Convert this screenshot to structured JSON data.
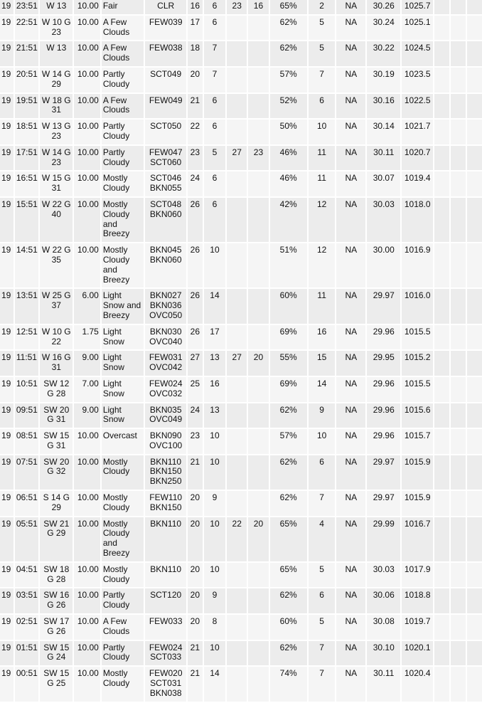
{
  "table": {
    "rows": [
      [
        "19",
        "23:51",
        "W 13",
        "10.00",
        "Fair",
        "CLR",
        "16",
        "6",
        "23",
        "16",
        "65%",
        "2",
        "NA",
        "30.26",
        "1025.7",
        "",
        "",
        ""
      ],
      [
        "19",
        "22:51",
        "W 10 G 23",
        "10.00",
        "A Few Clouds",
        "FEW039",
        "17",
        "6",
        "",
        "",
        "62%",
        "5",
        "NA",
        "30.24",
        "1025.1",
        "",
        "",
        ""
      ],
      [
        "19",
        "21:51",
        "W 13",
        "10.00",
        "A Few Clouds",
        "FEW038",
        "18",
        "7",
        "",
        "",
        "62%",
        "5",
        "NA",
        "30.22",
        "1024.5",
        "",
        "",
        ""
      ],
      [
        "19",
        "20:51",
        "W 14 G 29",
        "10.00",
        "Partly Cloudy",
        "SCT049",
        "20",
        "7",
        "",
        "",
        "57%",
        "7",
        "NA",
        "30.19",
        "1023.5",
        "",
        "",
        ""
      ],
      [
        "19",
        "19:51",
        "W 18 G 31",
        "10.00",
        "A Few Clouds",
        "FEW049",
        "21",
        "6",
        "",
        "",
        "52%",
        "6",
        "NA",
        "30.16",
        "1022.5",
        "",
        "",
        ""
      ],
      [
        "19",
        "18:51",
        "W 13 G 23",
        "10.00",
        "Partly Cloudy",
        "SCT050",
        "22",
        "6",
        "",
        "",
        "50%",
        "10",
        "NA",
        "30.14",
        "1021.7",
        "",
        "",
        ""
      ],
      [
        "19",
        "17:51",
        "W 14 G 23",
        "10.00",
        "Partly Cloudy",
        "FEW047 SCT060",
        "23",
        "5",
        "27",
        "23",
        "46%",
        "11",
        "NA",
        "30.11",
        "1020.7",
        "",
        "",
        ""
      ],
      [
        "19",
        "16:51",
        "W 15 G 31",
        "10.00",
        "Mostly Cloudy",
        "SCT046 BKN055",
        "24",
        "6",
        "",
        "",
        "46%",
        "11",
        "NA",
        "30.07",
        "1019.4",
        "",
        "",
        ""
      ],
      [
        "19",
        "15:51",
        "W 22 G 40",
        "10.00",
        "Mostly Cloudy and Breezy",
        "SCT048 BKN060",
        "26",
        "6",
        "",
        "",
        "42%",
        "12",
        "NA",
        "30.03",
        "1018.0",
        "",
        "",
        ""
      ],
      [
        "19",
        "14:51",
        "W 22 G 35",
        "10.00",
        "Mostly Cloudy and Breezy",
        "BKN045 BKN060",
        "26",
        "10",
        "",
        "",
        "51%",
        "12",
        "NA",
        "30.00",
        "1016.9",
        "",
        "",
        ""
      ],
      [
        "19",
        "13:51",
        "W 25 G 37",
        "6.00",
        "Light Snow and Breezy",
        "BKN027 BKN036 OVC050",
        "26",
        "14",
        "",
        "",
        "60%",
        "11",
        "NA",
        "29.97",
        "1016.0",
        "",
        "",
        ""
      ],
      [
        "19",
        "12:51",
        "W 10 G 22",
        "1.75",
        "Light Snow",
        "BKN030 OVC040",
        "26",
        "17",
        "",
        "",
        "69%",
        "16",
        "NA",
        "29.96",
        "1015.5",
        "",
        "",
        ""
      ],
      [
        "19",
        "11:51",
        "W 16 G 31",
        "9.00",
        "Light Snow",
        "FEW031 OVC042",
        "27",
        "13",
        "27",
        "20",
        "55%",
        "15",
        "NA",
        "29.95",
        "1015.2",
        "",
        "",
        ""
      ],
      [
        "19",
        "10:51",
        "SW 12 G 28",
        "7.00",
        "Light Snow",
        "FEW024 OVC032",
        "25",
        "16",
        "",
        "",
        "69%",
        "14",
        "NA",
        "29.96",
        "1015.5",
        "",
        "",
        ""
      ],
      [
        "19",
        "09:51",
        "SW 20 G 31",
        "9.00",
        "Light Snow",
        "BKN035 OVC049",
        "24",
        "13",
        "",
        "",
        "62%",
        "9",
        "NA",
        "29.96",
        "1015.6",
        "",
        "",
        ""
      ],
      [
        "19",
        "08:51",
        "SW 15 G 31",
        "10.00",
        "Overcast",
        "BKN090 OVC100",
        "23",
        "10",
        "",
        "",
        "57%",
        "10",
        "NA",
        "29.96",
        "1015.7",
        "",
        "",
        ""
      ],
      [
        "19",
        "07:51",
        "SW 20 G 32",
        "10.00",
        "Mostly Cloudy",
        "BKN110 BKN150 BKN250",
        "21",
        "10",
        "",
        "",
        "62%",
        "6",
        "NA",
        "29.97",
        "1015.9",
        "",
        "",
        ""
      ],
      [
        "19",
        "06:51",
        "S 14 G 29",
        "10.00",
        "Mostly Cloudy",
        "FEW110 BKN150",
        "20",
        "9",
        "",
        "",
        "62%",
        "7",
        "NA",
        "29.97",
        "1015.9",
        "",
        "",
        ""
      ],
      [
        "19",
        "05:51",
        "SW 21 G 29",
        "10.00",
        "Mostly Cloudy and Breezy",
        "BKN110",
        "20",
        "10",
        "22",
        "20",
        "65%",
        "4",
        "NA",
        "29.99",
        "1016.7",
        "",
        "",
        ""
      ],
      [
        "19",
        "04:51",
        "SW 18 G 28",
        "10.00",
        "Mostly Cloudy",
        "BKN110",
        "20",
        "10",
        "",
        "",
        "65%",
        "5",
        "NA",
        "30.03",
        "1017.9",
        "",
        "",
        ""
      ],
      [
        "19",
        "03:51",
        "SW 16 G 26",
        "10.00",
        "Partly Cloudy",
        "SCT120",
        "20",
        "9",
        "",
        "",
        "62%",
        "6",
        "NA",
        "30.06",
        "1018.8",
        "",
        "",
        ""
      ],
      [
        "19",
        "02:51",
        "SW 17 G 26",
        "10.00",
        "A Few Clouds",
        "FEW033",
        "20",
        "8",
        "",
        "",
        "60%",
        "5",
        "NA",
        "30.08",
        "1019.7",
        "",
        "",
        ""
      ],
      [
        "19",
        "01:51",
        "SW 15 G 24",
        "10.00",
        "Partly Cloudy",
        "FEW024 SCT033",
        "21",
        "10",
        "",
        "",
        "62%",
        "7",
        "NA",
        "30.10",
        "1020.1",
        "",
        "",
        ""
      ],
      [
        "19",
        "00:51",
        "SW 15 G 25",
        "10.00",
        "Mostly Cloudy",
        "FEW020 SCT031 BKN038",
        "21",
        "14",
        "",
        "",
        "74%",
        "7",
        "NA",
        "30.11",
        "1020.4",
        "",
        "",
        ""
      ]
    ]
  }
}
